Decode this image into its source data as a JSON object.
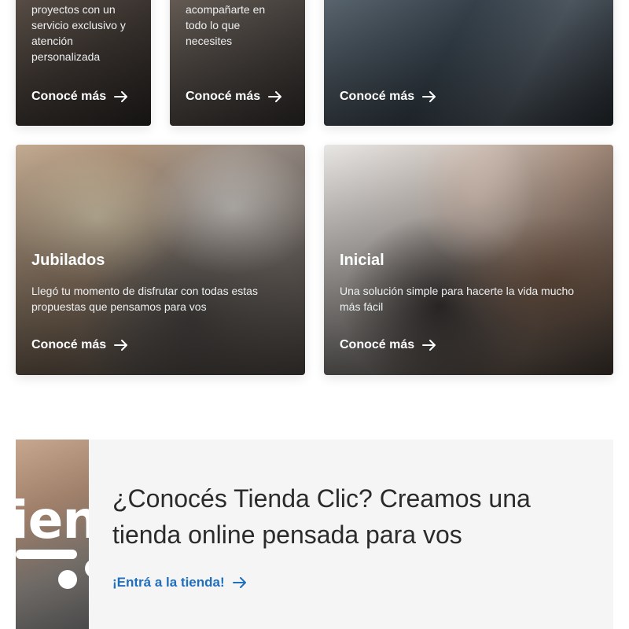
{
  "cards": {
    "empresas": {
      "description": "proyectos con un servicio exclusivo y atención personalizada",
      "link_label": "Conocé más"
    },
    "personas": {
      "description": "acompañarte en todo lo que necesites",
      "link_label": "Conocé más"
    },
    "familia": {
      "link_label": "Conocé más"
    },
    "jubilados": {
      "title": "Jubilados",
      "description": "Llegó tu momento de disfrutar con todas estas propuestas que pensamos para vos",
      "link_label": "Conocé más"
    },
    "inicial": {
      "title": "Inicial",
      "description": "Una solución simple para hacerte la vida mucho más fácil",
      "link_label": "Conocé más"
    }
  },
  "promo": {
    "image_text": "ien",
    "title": "¿Conocés Tienda Clic? Creamos una tienda online pensada para vos",
    "link_label": "¡Entrá a la tienda!"
  },
  "icons": {
    "card_link": "arrow-right-icon",
    "promo_link": "arrow-right-icon"
  },
  "colors": {
    "link_blue": "#1f6fbf",
    "promo_bg": "#f5f5f5",
    "text_dark": "#2b2b2b"
  }
}
